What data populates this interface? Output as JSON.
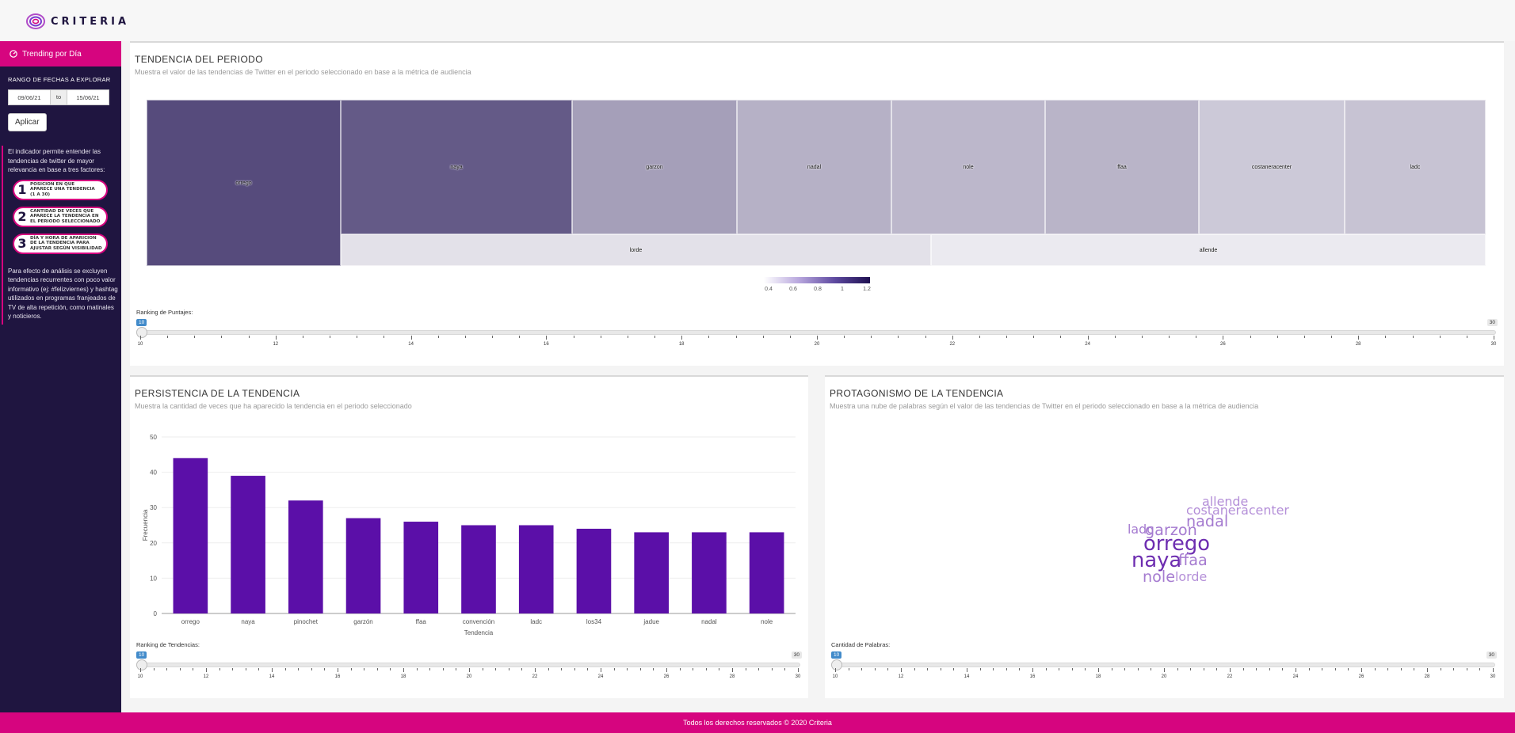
{
  "brand": {
    "name": "CRITERIA"
  },
  "sidebar": {
    "tab_label": "Trending por Día",
    "tab_icon": "dashboard-icon",
    "date_range_label": "RANGO DE FECHAS A EXPLORAR",
    "date_from": "09/06/21",
    "date_to": "15/06/21",
    "to_label": "to",
    "apply_label": "Aplicar",
    "intro": "El indicador permite entender las tendencias de twitter de mayor relevancia en base a tres factores:",
    "factors": [
      {
        "num": "1",
        "line1": "POSICION EN QUE",
        "line2": "APARECE UNA TENDENCIA",
        "line3": "(1 A 30)"
      },
      {
        "num": "2",
        "line1": "CANTIDAD DE VECES QUE",
        "line2": "APARECE LA TENDENCIA EN",
        "line3": "EL PERIODO SELECCIONADO"
      },
      {
        "num": "3",
        "line1": "DÍA Y HORA DE APARICION",
        "line2": "DE LA TENDENCIA PARA",
        "line3": "AJUSTAR SEGÚN VISIBILIDAD"
      }
    ],
    "note": "Para efecto de análisis se excluyen tendencias recurrentes con poco valor informativo (ej: #felizviernes) y hashtag utilizados en programas franjeados de TV de alta repetición, como matinales y noticieros."
  },
  "tendencia": {
    "title": "TENDENCIA DEL PERIODO",
    "subtitle": "Muestra el valor de las tendencias de Twitter en el periodo seleccionado en base a la métrica de audiencia",
    "cells": [
      {
        "label": "orrego",
        "value": 1.0
      },
      {
        "label": "naya",
        "value": 0.95
      },
      {
        "label": "garzon",
        "value": 0.72
      },
      {
        "label": "nadal",
        "value": 0.66
      },
      {
        "label": "nole",
        "value": 0.64
      },
      {
        "label": "ffaa",
        "value": 0.65
      },
      {
        "label": "costaneracenter",
        "value": 0.58
      },
      {
        "label": "ladc",
        "value": 0.6
      },
      {
        "label": "lorde",
        "value": 0.5
      },
      {
        "label": "allende",
        "value": 0.47
      }
    ],
    "colorbar_ticks": [
      "0.4",
      "0.6",
      "0.8",
      "1",
      "1.2"
    ],
    "slider_label": "Ranking de Puntajes:",
    "slider_min": "10",
    "slider_max": "30",
    "slider_ticks": [
      "10",
      "12",
      "14",
      "16",
      "18",
      "20",
      "22",
      "24",
      "26",
      "28",
      "30"
    ]
  },
  "persistencia": {
    "title": "PERSISTENCIA DE LA TENDENCIA",
    "subtitle": "Muestra la cantidad de veces que ha aparecido la tendencia en el periodo seleccionado",
    "slider_label": "Ranking de Tendencias:",
    "slider_min": "10",
    "slider_max": "30",
    "slider_ticks": [
      "10",
      "12",
      "14",
      "16",
      "18",
      "20",
      "22",
      "24",
      "26",
      "28",
      "30"
    ]
  },
  "protagonismo": {
    "title": "PROTAGONISMO DE LA TENDENCIA",
    "subtitle": "Muestra una nube de palabras según el valor de las tendencias de Twitter en el periodo seleccionado en base a la métrica de audiencia",
    "words": [
      {
        "text": "allende",
        "color": "#b48fd8",
        "weight": 3
      },
      {
        "text": "costaneracenter",
        "color": "#b48fd8",
        "weight": 3
      },
      {
        "text": "nadal",
        "color": "#a57bd0",
        "weight": 4
      },
      {
        "text": "ladc",
        "color": "#a57bd0",
        "weight": 3
      },
      {
        "text": "garzon",
        "color": "#a57bd0",
        "weight": 4
      },
      {
        "text": "orrego",
        "color": "#6d2db0",
        "weight": 6
      },
      {
        "text": "naya",
        "color": "#6d2db0",
        "weight": 6
      },
      {
        "text": "ffaa",
        "color": "#a57bd0",
        "weight": 4
      },
      {
        "text": "nole",
        "color": "#a57bd0",
        "weight": 4
      },
      {
        "text": "lorde",
        "color": "#b48fd8",
        "weight": 3
      }
    ],
    "slider_label": "Cantidad de Palabras:",
    "slider_min": "10",
    "slider_max": "30",
    "slider_ticks": [
      "10",
      "12",
      "14",
      "16",
      "18",
      "20",
      "22",
      "24",
      "26",
      "28",
      "30"
    ]
  },
  "chart_data": {
    "type": "bar",
    "categories": [
      "orrego",
      "naya",
      "pinochet",
      "garzón",
      "ffaa",
      "convención",
      "ladc",
      "los34",
      "jadue",
      "nadal",
      "nole"
    ],
    "values": [
      44,
      39,
      32,
      27,
      26,
      25,
      25,
      24,
      23,
      23,
      23
    ],
    "xlabel": "Tendencia",
    "ylabel": "Frecuencia",
    "ylim": [
      0,
      50
    ],
    "yticks": [
      0,
      10,
      20,
      30,
      40,
      50
    ],
    "grid": true,
    "color": "#5b0fa8"
  },
  "footer": {
    "text": "Todos los derechos reservados © 2020 Criteria"
  },
  "colors": {
    "accent": "#d6057f",
    "sidebar": "#1f1540",
    "bar": "#5b0fa8"
  }
}
